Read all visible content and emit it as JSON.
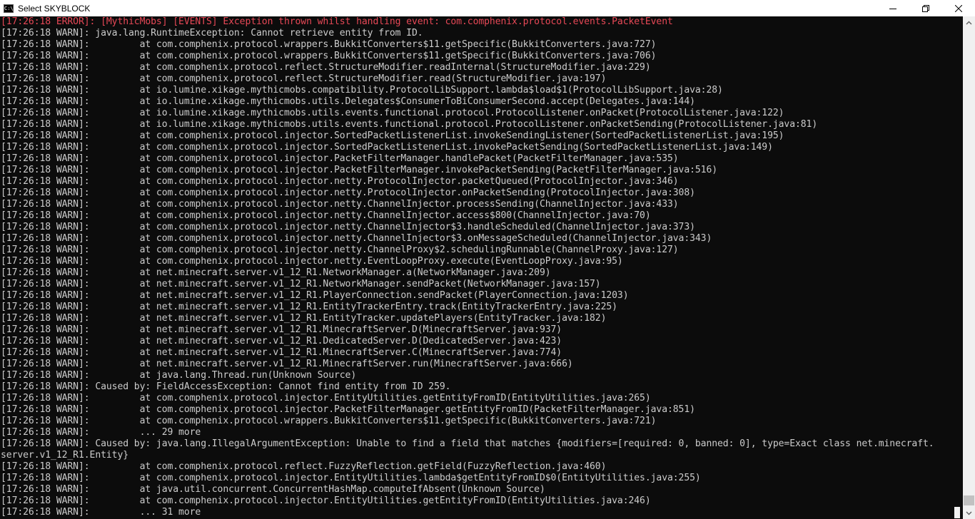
{
  "window": {
    "title": "Select SKYBLOCK",
    "icon": "cmd-icon",
    "icon_text": "C:\\"
  },
  "console": {
    "lines": [
      {
        "text": "[17:26:18 ERROR]: [MythicMobs] [EVENTS] Exception thrown whilst handling event: com.comphenix.protocol.events.PacketEvent",
        "level": "error"
      },
      {
        "text": "[17:26:18 WARN]: java.lang.RuntimeException: Cannot retrieve entity from ID.",
        "level": "warn"
      },
      {
        "text": "[17:26:18 WARN]:         at com.comphenix.protocol.wrappers.BukkitConverters$11.getSpecific(BukkitConverters.java:727)",
        "level": "warn"
      },
      {
        "text": "[17:26:18 WARN]:         at com.comphenix.protocol.wrappers.BukkitConverters$11.getSpecific(BukkitConverters.java:706)",
        "level": "warn"
      },
      {
        "text": "[17:26:18 WARN]:         at com.comphenix.protocol.reflect.StructureModifier.readInternal(StructureModifier.java:229)",
        "level": "warn"
      },
      {
        "text": "[17:26:18 WARN]:         at com.comphenix.protocol.reflect.StructureModifier.read(StructureModifier.java:197)",
        "level": "warn"
      },
      {
        "text": "[17:26:18 WARN]:         at io.lumine.xikage.mythicmobs.compatibility.ProtocolLibSupport.lambda$load$1(ProtocolLibSupport.java:28)",
        "level": "warn"
      },
      {
        "text": "[17:26:18 WARN]:         at io.lumine.xikage.mythicmobs.utils.Delegates$ConsumerToBiConsumerSecond.accept(Delegates.java:144)",
        "level": "warn"
      },
      {
        "text": "[17:26:18 WARN]:         at io.lumine.xikage.mythicmobs.utils.events.functional.protocol.ProtocolListener.onPacket(ProtocolListener.java:122)",
        "level": "warn"
      },
      {
        "text": "[17:26:18 WARN]:         at io.lumine.xikage.mythicmobs.utils.events.functional.protocol.ProtocolListener.onPacketSending(ProtocolListener.java:81)",
        "level": "warn"
      },
      {
        "text": "[17:26:18 WARN]:         at com.comphenix.protocol.injector.SortedPacketListenerList.invokeSendingListener(SortedPacketListenerList.java:195)",
        "level": "warn"
      },
      {
        "text": "[17:26:18 WARN]:         at com.comphenix.protocol.injector.SortedPacketListenerList.invokePacketSending(SortedPacketListenerList.java:149)",
        "level": "warn"
      },
      {
        "text": "[17:26:18 WARN]:         at com.comphenix.protocol.injector.PacketFilterManager.handlePacket(PacketFilterManager.java:535)",
        "level": "warn"
      },
      {
        "text": "[17:26:18 WARN]:         at com.comphenix.protocol.injector.PacketFilterManager.invokePacketSending(PacketFilterManager.java:516)",
        "level": "warn"
      },
      {
        "text": "[17:26:18 WARN]:         at com.comphenix.protocol.injector.netty.ProtocolInjector.packetQueued(ProtocolInjector.java:346)",
        "level": "warn"
      },
      {
        "text": "[17:26:18 WARN]:         at com.comphenix.protocol.injector.netty.ProtocolInjector.onPacketSending(ProtocolInjector.java:308)",
        "level": "warn"
      },
      {
        "text": "[17:26:18 WARN]:         at com.comphenix.protocol.injector.netty.ChannelInjector.processSending(ChannelInjector.java:433)",
        "level": "warn"
      },
      {
        "text": "[17:26:18 WARN]:         at com.comphenix.protocol.injector.netty.ChannelInjector.access$800(ChannelInjector.java:70)",
        "level": "warn"
      },
      {
        "text": "[17:26:18 WARN]:         at com.comphenix.protocol.injector.netty.ChannelInjector$3.handleScheduled(ChannelInjector.java:373)",
        "level": "warn"
      },
      {
        "text": "[17:26:18 WARN]:         at com.comphenix.protocol.injector.netty.ChannelInjector$3.onMessageScheduled(ChannelInjector.java:343)",
        "level": "warn"
      },
      {
        "text": "[17:26:18 WARN]:         at com.comphenix.protocol.injector.netty.ChannelProxy$2.schedulingRunnable(ChannelProxy.java:127)",
        "level": "warn"
      },
      {
        "text": "[17:26:18 WARN]:         at com.comphenix.protocol.injector.netty.EventLoopProxy.execute(EventLoopProxy.java:95)",
        "level": "warn"
      },
      {
        "text": "[17:26:18 WARN]:         at net.minecraft.server.v1_12_R1.NetworkManager.a(NetworkManager.java:209)",
        "level": "warn"
      },
      {
        "text": "[17:26:18 WARN]:         at net.minecraft.server.v1_12_R1.NetworkManager.sendPacket(NetworkManager.java:157)",
        "level": "warn"
      },
      {
        "text": "[17:26:18 WARN]:         at net.minecraft.server.v1_12_R1.PlayerConnection.sendPacket(PlayerConnection.java:1203)",
        "level": "warn"
      },
      {
        "text": "[17:26:18 WARN]:         at net.minecraft.server.v1_12_R1.EntityTrackerEntry.track(EntityTrackerEntry.java:225)",
        "level": "warn"
      },
      {
        "text": "[17:26:18 WARN]:         at net.minecraft.server.v1_12_R1.EntityTracker.updatePlayers(EntityTracker.java:182)",
        "level": "warn"
      },
      {
        "text": "[17:26:18 WARN]:         at net.minecraft.server.v1_12_R1.MinecraftServer.D(MinecraftServer.java:937)",
        "level": "warn"
      },
      {
        "text": "[17:26:18 WARN]:         at net.minecraft.server.v1_12_R1.DedicatedServer.D(DedicatedServer.java:423)",
        "level": "warn"
      },
      {
        "text": "[17:26:18 WARN]:         at net.minecraft.server.v1_12_R1.MinecraftServer.C(MinecraftServer.java:774)",
        "level": "warn"
      },
      {
        "text": "[17:26:18 WARN]:         at net.minecraft.server.v1_12_R1.MinecraftServer.run(MinecraftServer.java:666)",
        "level": "warn"
      },
      {
        "text": "[17:26:18 WARN]:         at java.lang.Thread.run(Unknown Source)",
        "level": "warn"
      },
      {
        "text": "[17:26:18 WARN]: Caused by: FieldAccessException: Cannot find entity from ID 259.",
        "level": "warn"
      },
      {
        "text": "[17:26:18 WARN]:         at com.comphenix.protocol.injector.EntityUtilities.getEntityFromID(EntityUtilities.java:265)",
        "level": "warn"
      },
      {
        "text": "[17:26:18 WARN]:         at com.comphenix.protocol.injector.PacketFilterManager.getEntityFromID(PacketFilterManager.java:851)",
        "level": "warn"
      },
      {
        "text": "[17:26:18 WARN]:         at com.comphenix.protocol.wrappers.BukkitConverters$11.getSpecific(BukkitConverters.java:721)",
        "level": "warn"
      },
      {
        "text": "[17:26:18 WARN]:         ... 29 more",
        "level": "warn"
      },
      {
        "text": "[17:26:18 WARN]: Caused by: java.lang.IllegalArgumentException: Unable to find a field that matches {modifiers=[required: 0, banned: 0], type=Exact class net.minecraft.",
        "level": "warn"
      },
      {
        "text": "server.v1_12_R1.Entity}",
        "level": "warn"
      },
      {
        "text": "[17:26:18 WARN]:         at com.comphenix.protocol.reflect.FuzzyReflection.getField(FuzzyReflection.java:460)",
        "level": "warn"
      },
      {
        "text": "[17:26:18 WARN]:         at com.comphenix.protocol.injector.EntityUtilities.lambda$getEntityFromID$0(EntityUtilities.java:255)",
        "level": "warn"
      },
      {
        "text": "[17:26:18 WARN]:         at java.util.concurrent.ConcurrentHashMap.computeIfAbsent(Unknown Source)",
        "level": "warn"
      },
      {
        "text": "[17:26:18 WARN]:         at com.comphenix.protocol.injector.EntityUtilities.getEntityFromID(EntityUtilities.java:246)",
        "level": "warn"
      },
      {
        "text": "[17:26:18 WARN]:         ... 31 more",
        "level": "warn"
      }
    ]
  },
  "colors": {
    "background": "#0c0c0c",
    "text": "#cccccc",
    "error": "#e74856",
    "titlebar": "#ffffff"
  }
}
